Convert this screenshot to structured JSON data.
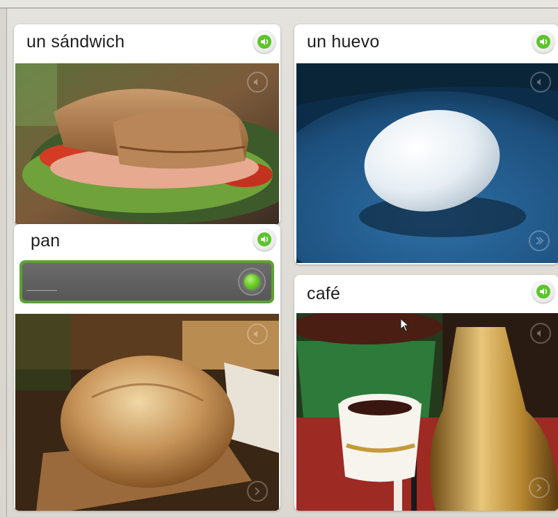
{
  "cards": [
    {
      "id": "sandwich",
      "title": "un sándwich"
    },
    {
      "id": "huevo",
      "title": "un huevo"
    },
    {
      "id": "pan",
      "title": "pan"
    },
    {
      "id": "cafe",
      "title": "café"
    }
  ],
  "answer": {
    "value": ""
  },
  "colors": {
    "accent_green": "#5ea135",
    "speaker_green": "#5cc42b",
    "mic_active": "#6fcf2a",
    "field_gray": "#616161"
  },
  "icons": {
    "speaker": "speaker-icon",
    "mic": "microphone-icon",
    "cursor": "mouse-cursor-icon"
  }
}
